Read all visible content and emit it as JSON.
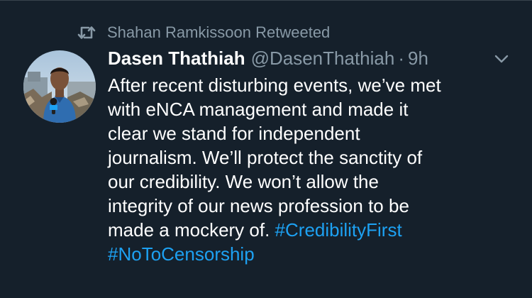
{
  "retweet": {
    "icon": "retweet-icon",
    "text": "Shahan Ramkissoon Retweeted"
  },
  "author": {
    "display_name": "Dasen Thathiah",
    "handle": "@DasenThathiah",
    "separator": "·",
    "time": "9h",
    "avatar": "avatar-photo"
  },
  "menu": {
    "icon": "chevron-down-icon"
  },
  "tweet": {
    "lines": [
      "After recent disturbing events, we’ve met",
      "with eNCA management and made it",
      "clear we stand for independent",
      "journalism. We’ll protect the sanctity of",
      "our credibility. We won’t allow the",
      "integrity of our news profession to be",
      "made a mockery of."
    ],
    "hashtags": [
      "#CredibilityFirst",
      "#NoToCensorship"
    ]
  },
  "colors": {
    "background": "#15202b",
    "text": "#ffffff",
    "muted": "#8899a6",
    "link": "#1da1f2"
  }
}
